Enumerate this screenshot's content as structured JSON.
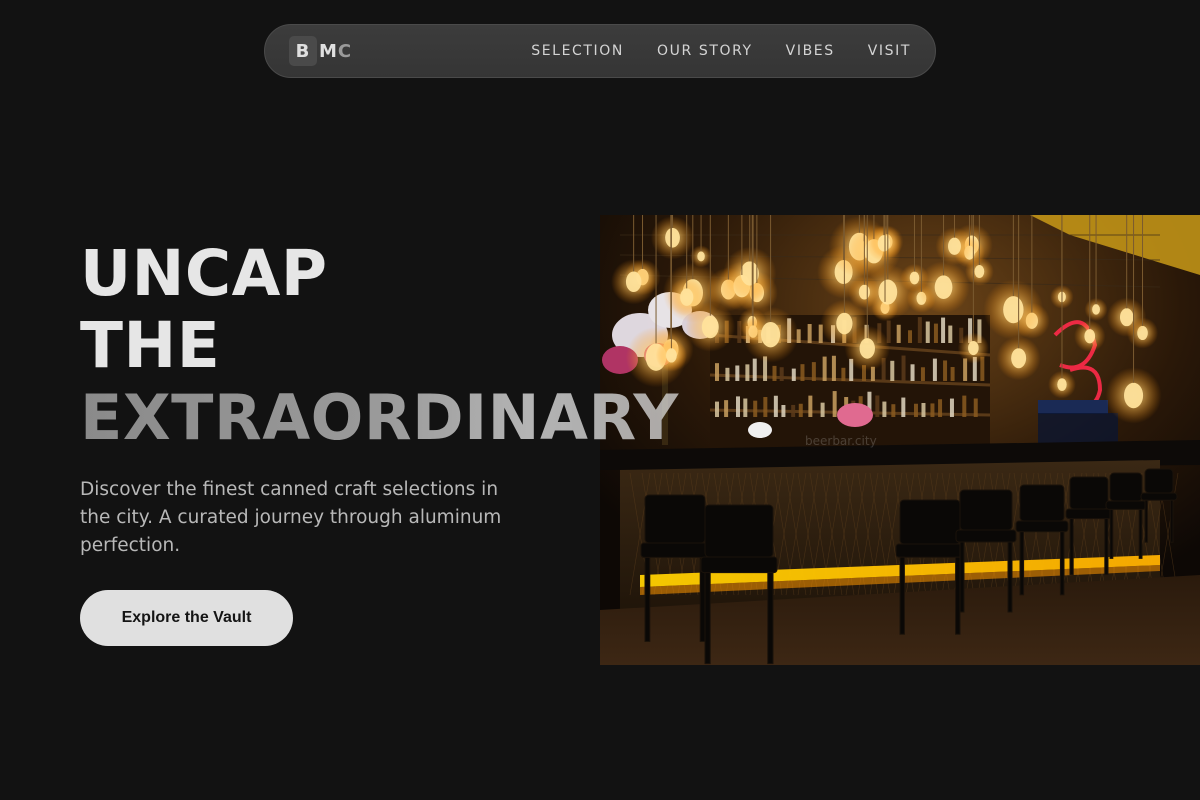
{
  "nav": {
    "logo": {
      "first": "B",
      "middle": "M",
      "last": "C"
    },
    "links": [
      "SELECTION",
      "OUR STORY",
      "VIBES",
      "VISIT"
    ]
  },
  "hero": {
    "headline": [
      "UNCAP",
      "THE",
      "EXTRAORDINARY"
    ],
    "subtitle": "Discover the finest canned craft selections in the city. A curated journey through aluminum perfection.",
    "cta_label": "Explore the Vault",
    "image_icon": "bar-interior-photo"
  },
  "colors": {
    "background": "#121212",
    "nav_bg": "#383838",
    "cta_bg": "#e0e0e0",
    "bulb_glow": "#ffb347",
    "neon_red": "#ff2a4a"
  }
}
